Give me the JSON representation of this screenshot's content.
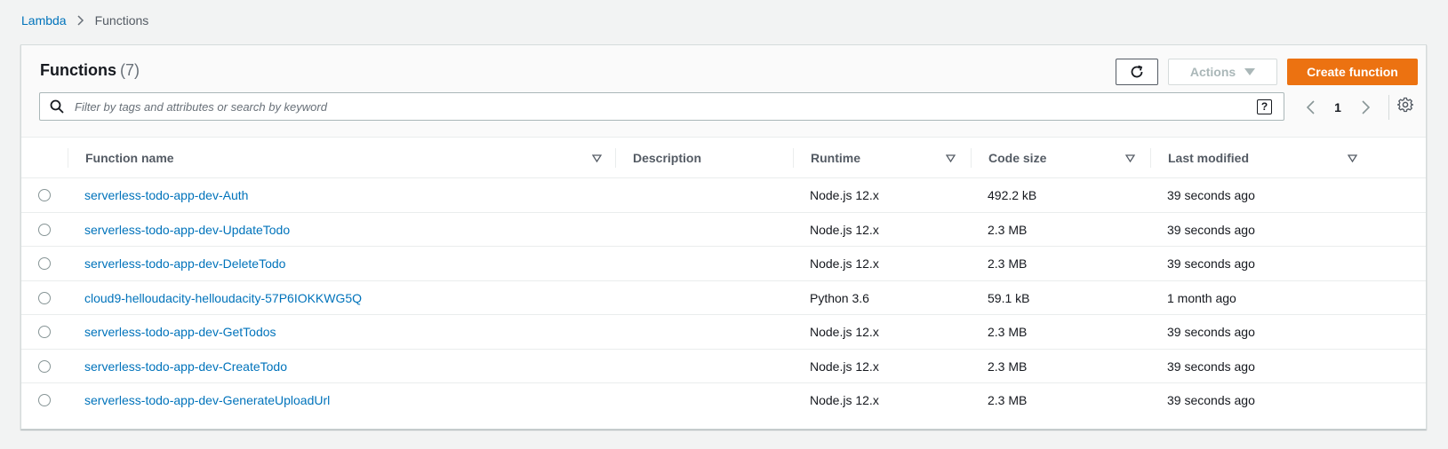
{
  "breadcrumb": {
    "root": "Lambda",
    "current": "Functions"
  },
  "header": {
    "title": "Functions",
    "count": "(7)",
    "actions_label": "Actions",
    "create_label": "Create function"
  },
  "search": {
    "placeholder": "Filter by tags and attributes or search by keyword",
    "value": "",
    "help_label": "?"
  },
  "pagination": {
    "current_page": "1"
  },
  "table": {
    "columns": {
      "name": "Function name",
      "description": "Description",
      "runtime": "Runtime",
      "code_size": "Code size",
      "last_modified": "Last modified"
    },
    "rows": [
      {
        "name": "serverless-todo-app-dev-Auth",
        "description": "",
        "runtime": "Node.js 12.x",
        "code_size": "492.2 kB",
        "last_modified": "39 seconds ago"
      },
      {
        "name": "serverless-todo-app-dev-UpdateTodo",
        "description": "",
        "runtime": "Node.js 12.x",
        "code_size": "2.3 MB",
        "last_modified": "39 seconds ago"
      },
      {
        "name": "serverless-todo-app-dev-DeleteTodo",
        "description": "",
        "runtime": "Node.js 12.x",
        "code_size": "2.3 MB",
        "last_modified": "39 seconds ago"
      },
      {
        "name": "cloud9-helloudacity-helloudacity-57P6IOKKWG5Q",
        "description": "",
        "runtime": "Python 3.6",
        "code_size": "59.1 kB",
        "last_modified": "1 month ago"
      },
      {
        "name": "serverless-todo-app-dev-GetTodos",
        "description": "",
        "runtime": "Node.js 12.x",
        "code_size": "2.3 MB",
        "last_modified": "39 seconds ago"
      },
      {
        "name": "serverless-todo-app-dev-CreateTodo",
        "description": "",
        "runtime": "Node.js 12.x",
        "code_size": "2.3 MB",
        "last_modified": "39 seconds ago"
      },
      {
        "name": "serverless-todo-app-dev-GenerateUploadUrl",
        "description": "",
        "runtime": "Node.js 12.x",
        "code_size": "2.3 MB",
        "last_modified": "39 seconds ago"
      }
    ]
  },
  "icons": {
    "breadcrumb_separator": "chevron-right-icon",
    "refresh": "refresh-icon",
    "actions_caret": "caret-down-icon",
    "search": "search-icon",
    "prev_page": "chevron-left-icon",
    "next_page": "chevron-right-icon",
    "settings": "gear-icon",
    "sort": "sort-caret-icon"
  },
  "colors": {
    "primary": "#ec7211",
    "link": "#0073bb",
    "background": "#f2f3f3"
  }
}
